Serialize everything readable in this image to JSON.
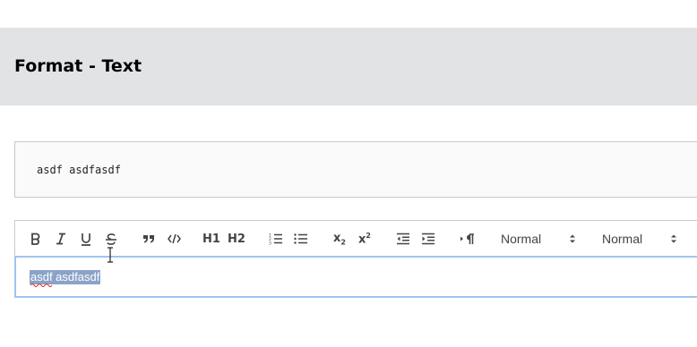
{
  "header": {
    "title": "Format - Text"
  },
  "preview": {
    "text": "asdf asdfasdf"
  },
  "toolbar": {
    "h1_label": "H1",
    "h2_label": "H2",
    "x_sub_label": "x",
    "x_sup_label": "x",
    "size_picker": "Normal",
    "header_picker": "Normal"
  },
  "editor": {
    "selected_text": "asdf asdfasdf"
  },
  "colors": {
    "header_bg": "#e2e3e4",
    "focus_border": "#9ec5ef",
    "selection": "#8aa3c8"
  }
}
